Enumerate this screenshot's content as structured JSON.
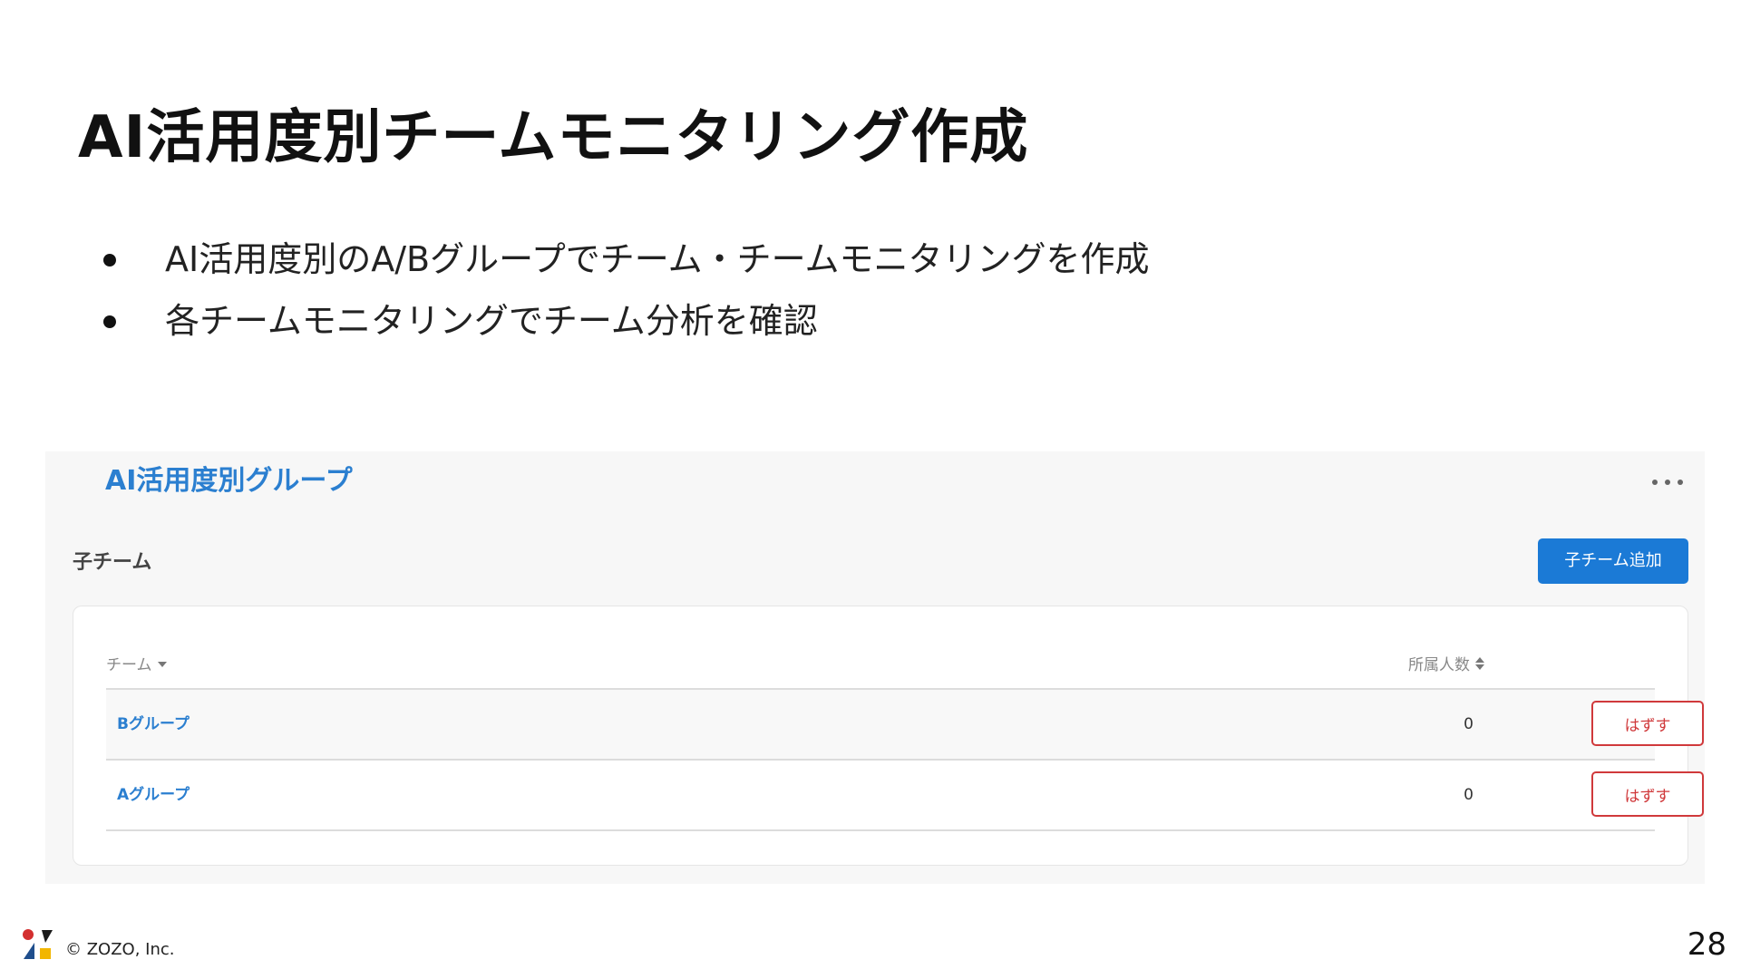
{
  "slide": {
    "title": "AI活用度別チームモニタリング作成",
    "bullets": [
      "AI活用度別のA/Bグループでチーム・チームモニタリングを作成",
      "各チームモニタリングでチーム分析を確認"
    ],
    "page_number": "28"
  },
  "panel": {
    "title": "AI活用度別グループ",
    "section_label": "子チーム",
    "add_button_label": "子チーム追加",
    "table": {
      "columns": [
        "チーム",
        "所属人数"
      ],
      "rows": [
        {
          "team": "Bグループ",
          "members": "0",
          "action": "はずす"
        },
        {
          "team": "Aグループ",
          "members": "0",
          "action": "はずす"
        }
      ]
    }
  },
  "footer": {
    "copyright": "© ZOZO, Inc."
  },
  "colors": {
    "accent_blue": "#1b7ad6",
    "link_blue": "#2b7fd0",
    "danger_red": "#d0393b",
    "panel_bg": "#f7f7f7"
  },
  "icons": [
    "more-icon",
    "caret-down-icon",
    "sort-icon",
    "zozo-logo"
  ]
}
